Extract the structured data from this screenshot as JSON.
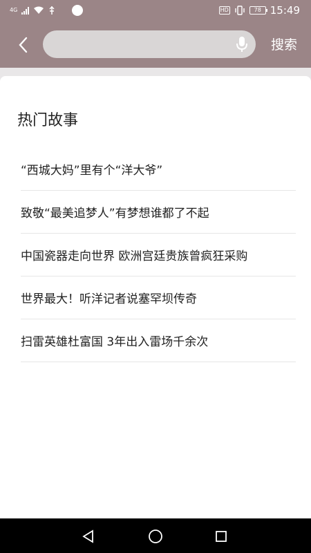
{
  "status_bar": {
    "network": "4G",
    "time": "15:49",
    "battery": "78",
    "hd": "HD"
  },
  "header": {
    "search_placeholder": "",
    "search_value": "",
    "search_button_label": "搜索"
  },
  "content": {
    "section_title": "热门故事",
    "stories": [
      {
        "title": "“西城大妈”里有个“洋大爷”"
      },
      {
        "title": "致敬“最美追梦人”有梦想谁都了不起"
      },
      {
        "title": "中国瓷器走向世界 欧洲宫廷贵族曾疯狂采购"
      },
      {
        "title": "世界最大！听洋记者说塞罕坝传奇"
      },
      {
        "title": "扫雷英雄杜富国 3年出入雷场千余次"
      }
    ]
  },
  "icons": {
    "back": "back-arrow-icon",
    "mic": "microphone-icon",
    "nav_back": "triangle-back-icon",
    "nav_home": "circle-home-icon",
    "nav_recents": "square-recents-icon"
  }
}
